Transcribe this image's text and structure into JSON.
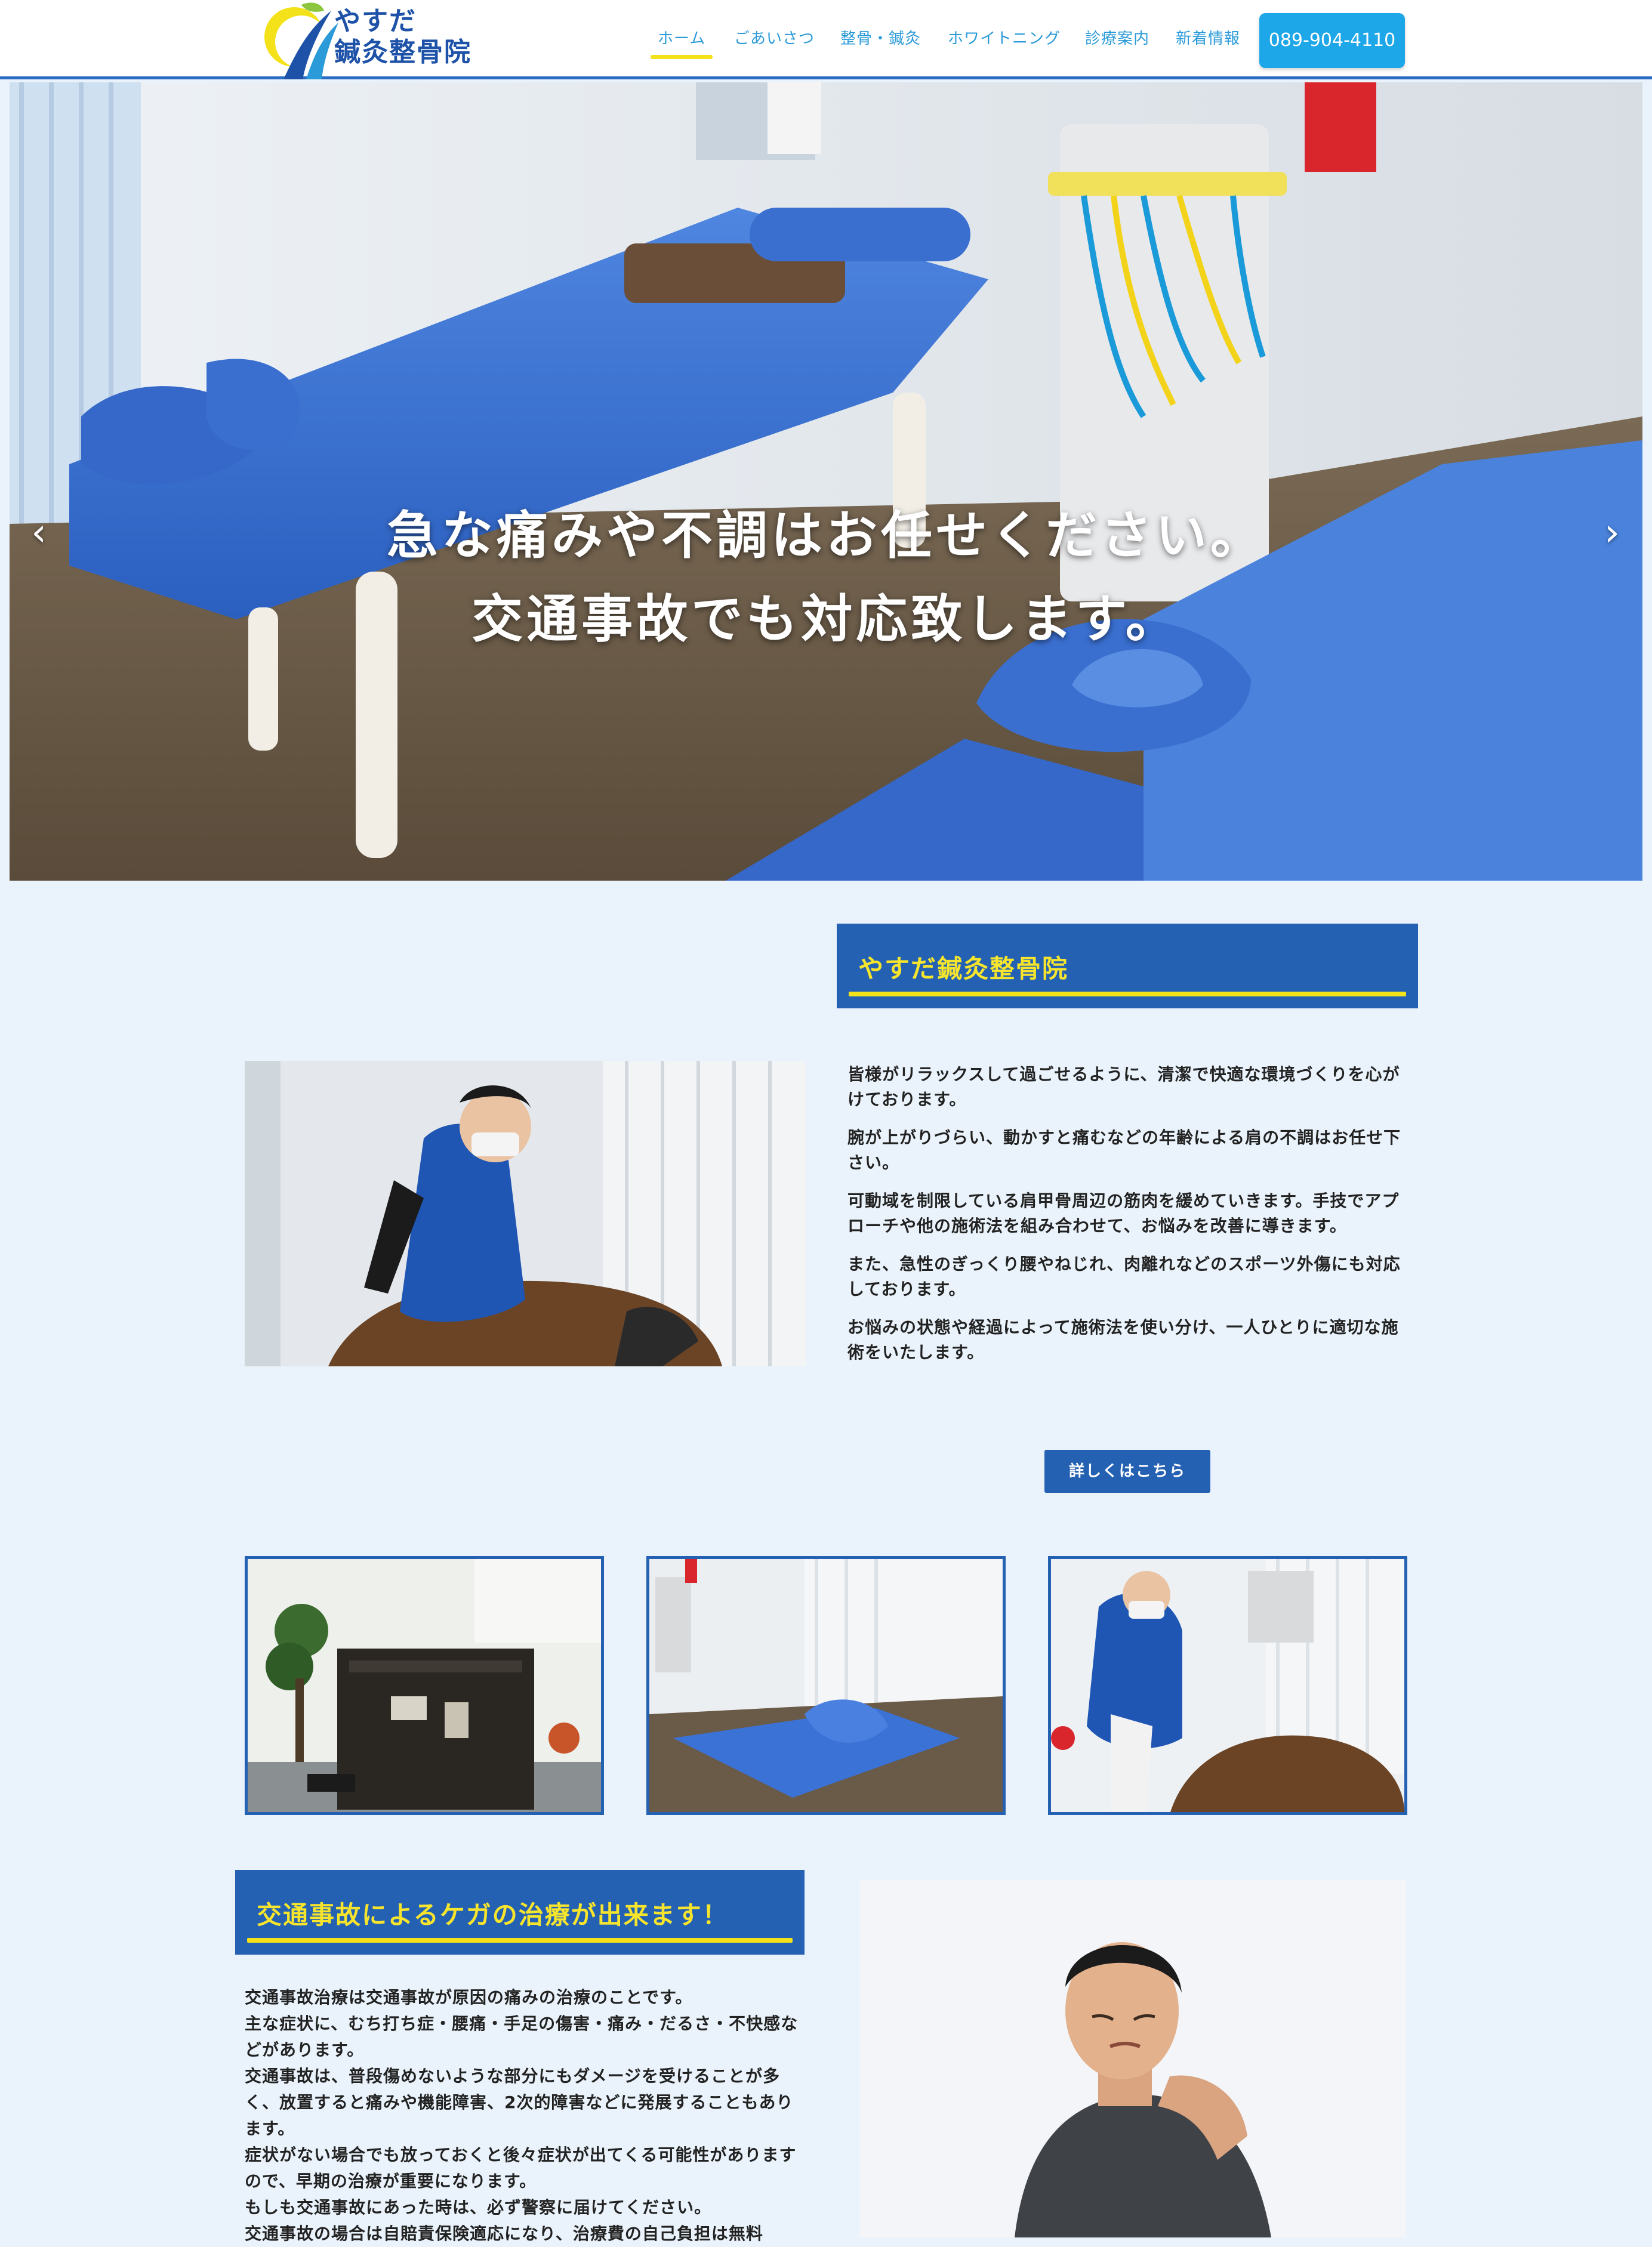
{
  "header": {
    "logo_line1": "やすだ",
    "logo_line2": "鍼灸整骨院",
    "nav": [
      {
        "label": "ホーム",
        "active": true
      },
      {
        "label": "ごあいさつ",
        "active": false
      },
      {
        "label": "整骨・鍼灸",
        "active": false
      },
      {
        "label": "ホワイトニング",
        "active": false
      },
      {
        "label": "診療案内",
        "active": false
      },
      {
        "label": "新着情報",
        "active": false
      }
    ],
    "phone": "089-904-4110"
  },
  "hero": {
    "line1": "急な痛みや不調はお任せください。",
    "line2": "交通事故でも対応致します。",
    "prev_icon": "chevron-left-icon",
    "next_icon": "chevron-right-icon"
  },
  "intro": {
    "title": "やすだ鍼灸整骨院",
    "paragraphs": [
      "皆様がリラックスして過ごせるように、清潔で快適な環境づくりを心がけております。",
      "腕が上がりづらい、動かすと痛むなどの年齢による肩の不調はお任せ下さい。",
      "可動域を制限している肩甲骨周辺の筋肉を緩めていきます。手技でアプローチや他の施術法を組み合わせて、お悩みを改善に導きます。",
      "また、急性のぎっくり腰やねじれ、肉離れなどのスポーツ外傷にも対応しております。",
      "お悩みの状態や経過によって施術法を使い分け、一人ひとりに適切な施術をいたします。"
    ],
    "button": "詳しくはこちら"
  },
  "accident": {
    "title": "交通事故によるケガの治療が出来ます！",
    "lines": [
      "交通事故治療は交通事故が原因の痛みの治療のことです。",
      "主な症状に、むち打ち症・腰痛・手足の傷害・痛み・だるさ・不快感などがあります。",
      "交通事故は、普段傷めないような部分にもダメージを受けることが多く、放置すると痛みや機能障害、2次的障害などに発展することもあります。",
      "症状がない場合でも放っておくと後々症状が出てくる可能性がありますので、早期の治療が重要になります。",
      "もしも交通事故にあった時は、必ず警察に届けてください。",
      "交通事故の場合は自賠責保険適応になり、治療費の自己負担は無料"
    ]
  },
  "colors": {
    "primary": "#2461b3",
    "accent_yellow": "#f3e21a",
    "nav_text": "#2a9ad8",
    "phone_button": "#1ea7e8",
    "page_bg": "#eaf3fb"
  }
}
